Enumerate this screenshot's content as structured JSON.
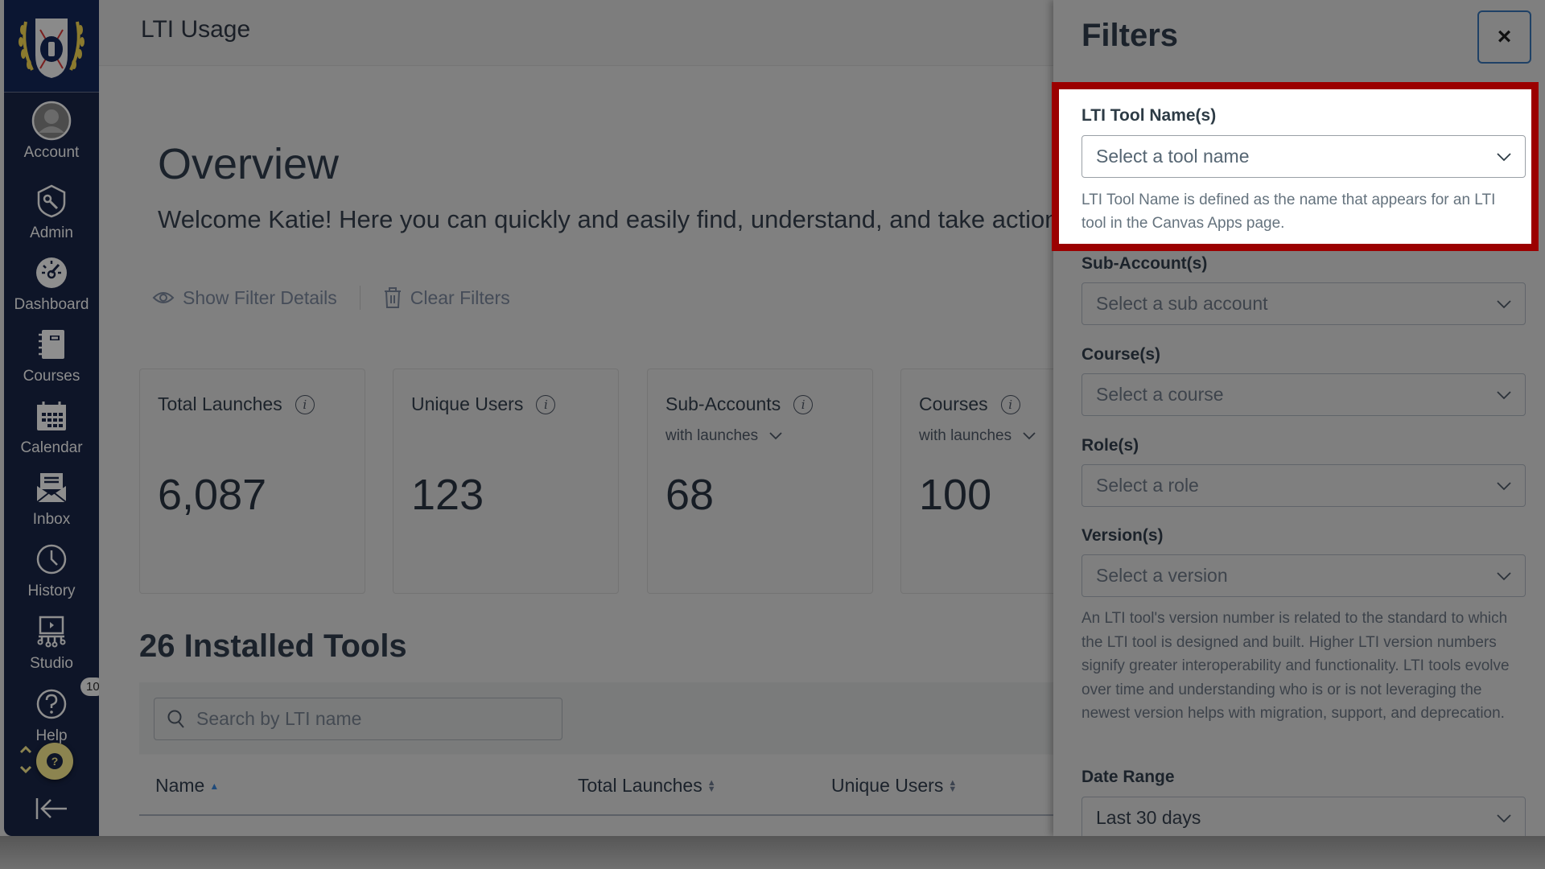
{
  "sidebar": {
    "logo": "institution-crest-logo",
    "items": [
      {
        "label": "Account",
        "icon": "account-avatar-icon"
      },
      {
        "label": "Admin",
        "icon": "admin-shield-key-icon"
      },
      {
        "label": "Dashboard",
        "icon": "dashboard-gauge-icon"
      },
      {
        "label": "Courses",
        "icon": "courses-notebook-icon"
      },
      {
        "label": "Calendar",
        "icon": "calendar-icon"
      },
      {
        "label": "Inbox",
        "icon": "inbox-envelope-icon"
      },
      {
        "label": "History",
        "icon": "history-clock-icon"
      },
      {
        "label": "Studio",
        "icon": "studio-icon"
      },
      {
        "label": "Help",
        "icon": "help-icon",
        "badge": "10"
      }
    ],
    "help_fab_glyph": "?",
    "collapse_icon": "collapse-arrow-icon"
  },
  "header": {
    "title": "LTI Usage"
  },
  "overview": {
    "title": "Overview",
    "welcome": "Welcome Katie! Here you can quickly and easily find, understand, and take action on"
  },
  "filter_actions": {
    "show_details": "Show Filter Details",
    "clear": "Clear Filters"
  },
  "cards": [
    {
      "title": "Total Launches",
      "subtitle": null,
      "value": "6,087"
    },
    {
      "title": "Unique Users",
      "subtitle": null,
      "value": "123"
    },
    {
      "title": "Sub-Accounts",
      "subtitle": "with launches",
      "value": "68"
    },
    {
      "title": "Courses",
      "subtitle": "with launches",
      "value": "100"
    }
  ],
  "tools": {
    "title": "26 Installed Tools",
    "search_placeholder": "Search by LTI name",
    "columns": [
      {
        "label": "Name",
        "sort": "ascending"
      },
      {
        "label": "Total Launches",
        "sort": "none"
      },
      {
        "label": "Unique Users",
        "sort": "none"
      }
    ]
  },
  "filters_panel": {
    "title": "Filters",
    "close_glyph": "×",
    "fields": [
      {
        "label": "LTI Tool Name(s)",
        "placeholder": "Select a tool name",
        "hint": "LTI Tool Name is defined as the name that appears for an LTI tool in the Canvas Apps page.",
        "highlighted": true
      },
      {
        "label": "Sub-Account(s)",
        "placeholder": "Select a sub account"
      },
      {
        "label": "Course(s)",
        "placeholder": "Select a course"
      },
      {
        "label": "Role(s)",
        "placeholder": "Select a role"
      },
      {
        "label": "Version(s)",
        "placeholder": "Select a version",
        "hint": "An LTI tool's version number is related to the standard to which the LTI tool is designed and built. Higher LTI version numbers signify greater interoperability and functionality. LTI tools evolve over time and understanding who is or is not leveraging the newest version helps with migration, support, and deprecation."
      },
      {
        "label": "Date Range",
        "value": "Last 30 days"
      }
    ]
  },
  "colors": {
    "highlight_border": "#9b0000",
    "sidebar_bg": "#0e1528",
    "help_fab": "#8c8450"
  }
}
